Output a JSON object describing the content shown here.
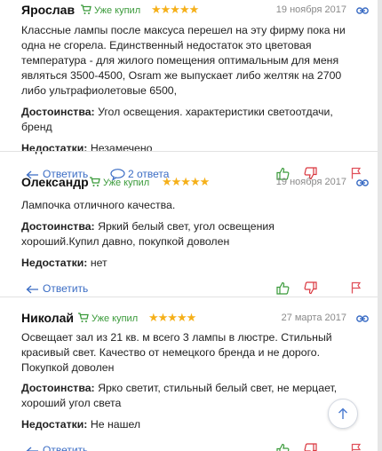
{
  "reviews": [
    {
      "author": "Ярослав",
      "bought": "Уже купил",
      "stars": "★★★★★",
      "date": "19 ноября 2017",
      "text": "Классные лампы после максуса перешел на эту фирму пока ни одна не сгорела. Единственный недостаток это цветовая температура - для жилого помещения оптимальным для меня являться 3500-4500, Osram же выпускает либо желтяк на 2700 либо ультрафиолетовые 6500,",
      "pros_label": "Достоинства:",
      "pros": "Угол освещения. характеристики светоотдачи, бренд",
      "cons_label": "Недостатки:",
      "cons": "Незамечено",
      "reply": "Ответить",
      "answers": "2 ответа"
    },
    {
      "author": "Олександр",
      "bought": "Уже купил",
      "stars": "★★★★★",
      "date": "19 ноября 2017",
      "text": "Лампочка отличного качества.",
      "pros_label": "Достоинства:",
      "pros": "Яркий белый свет, угол освещения хороший.Купил давно, покупкой доволен",
      "cons_label": "Недостатки:",
      "cons": "нет",
      "reply": "Ответить"
    },
    {
      "author": "Николай",
      "bought": "Уже купил",
      "stars": "★★★★★",
      "date": "27 марта 2017",
      "text": "Освещает зал из 21 кв. м всего 3 лампы в люстре. Стильный красивый свет. Качество от немецкого бренда и не дорого. Покупкой доволен",
      "pros_label": "Достоинства:",
      "pros": "Ярко светит, стильный белый свет, не мерцает, хороший угол света",
      "cons_label": "Недостатки:",
      "cons": "Не нашел",
      "reply": "Ответить"
    }
  ],
  "colors": {
    "link": "#3a6cc4",
    "bought": "#3a9a3a",
    "stars": "#f5b01a",
    "like": "#3a9a3a",
    "dislike": "#d9363e",
    "flag": "#e0505a"
  }
}
